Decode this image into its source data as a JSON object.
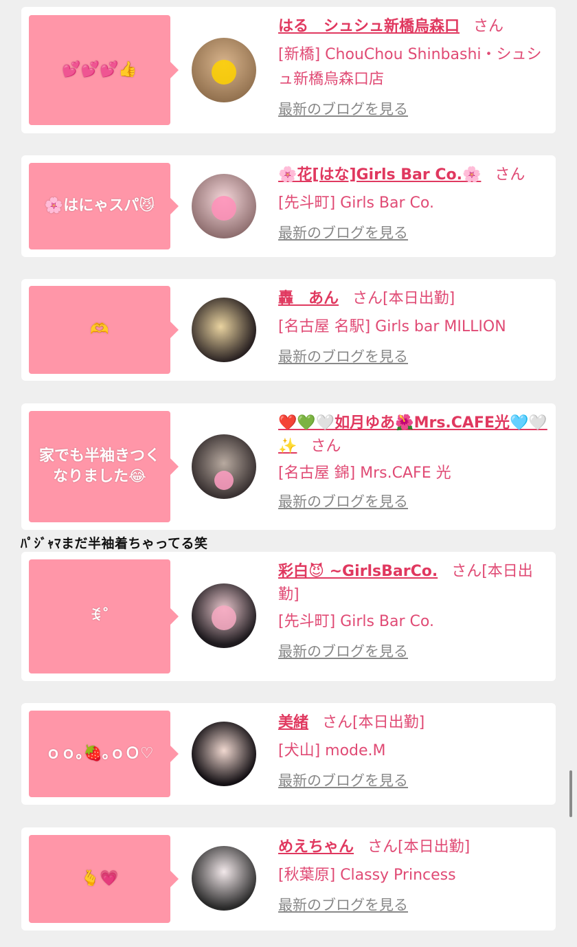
{
  "suffix": "さん",
  "blog_link": "最新のブログを見る",
  "colors": {
    "accent": "#e0385f",
    "bubble": "#ff96a8",
    "background": "#efefef"
  },
  "entries": [
    {
      "bubble": "💕💕💕👍",
      "name": "はる　シュシュ新橋烏森口",
      "tag": "",
      "shop": "[新橋] ChouChou Shinbashi・シュシュ新橋烏森口店"
    },
    {
      "bubble": "🌸はにゃスパ😼",
      "name": "🌸花[はな]Girls Bar Co.🌸",
      "tag": "",
      "shop": "[先斗町] Girls Bar Co."
    },
    {
      "bubble": "🫶",
      "name": "轟　あん",
      "tag": "[本日出勤]",
      "shop": "[名古屋 名駅] Girls bar MILLION"
    },
    {
      "bubble": "家でも半袖きつく\nなりました😂",
      "name": "❤️💚🤍如月ゆあ🌺Mrs.CAFE光🩵🤍✨",
      "tag": "",
      "shop": "[名古屋 錦] Mrs.CAFE 光"
    },
    {
      "bubble": "ꉂ˚",
      "name": "彩白😈 ~GirlsBarCo.",
      "tag": "[本日出勤]",
      "shop": "[先斗町] Girls Bar Co."
    },
    {
      "bubble": "ｏｏ｡🍓｡ｏＯ♡",
      "name": "美緒",
      "tag": "[本日出勤]",
      "shop": "[犬山] mode.M"
    },
    {
      "bubble": "🫰💗",
      "name": "めえちゃん",
      "tag": "[本日出勤]",
      "shop": "[秋葉原] Classy Princess"
    }
  ],
  "overflow_caption": "ﾊﾟｼﾞｬﾏまだ半袖着ちゃってる笑"
}
